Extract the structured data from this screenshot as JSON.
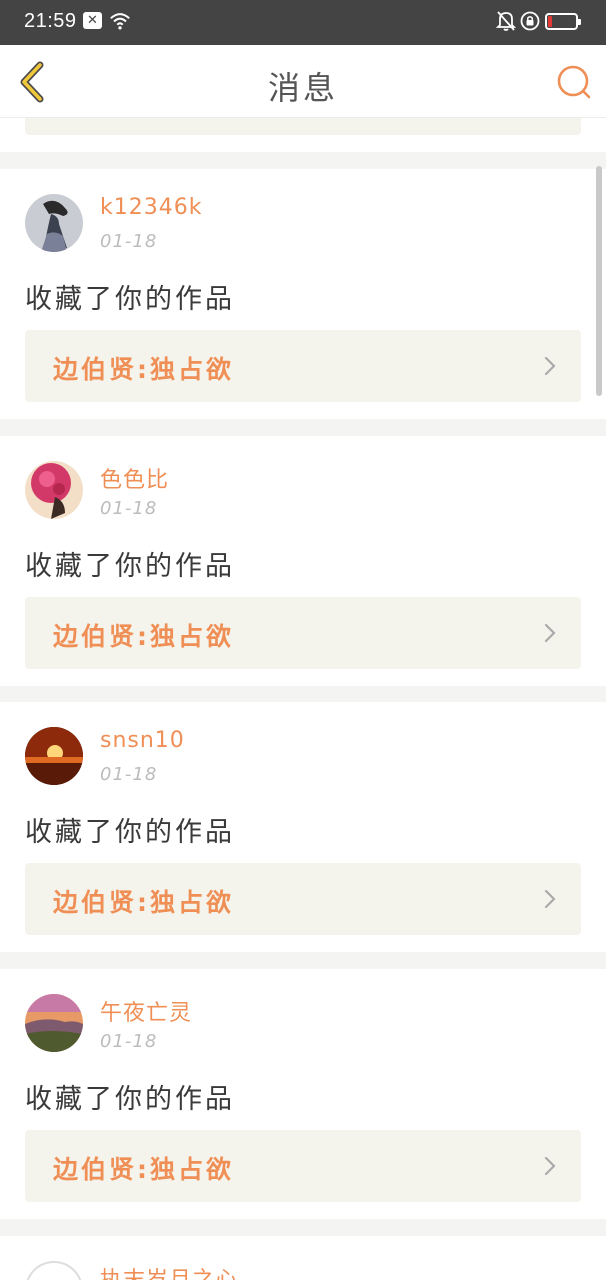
{
  "status_bar": {
    "time": "21:59",
    "icons": [
      "close-box-icon",
      "wifi-icon",
      "bell-off-icon",
      "lock-rotate-icon",
      "battery-low-icon"
    ]
  },
  "header": {
    "title": "消息",
    "back_icon": "chevron-left-icon",
    "search_icon": "search-icon"
  },
  "colors": {
    "accent": "#ef8f56",
    "back_arrow": "#f2c83b",
    "text_dark": "#3a3a3a",
    "date_gray": "#bcbcbc",
    "card_link_bg": "#f5f4ec"
  },
  "messages": [
    {
      "username": "k12346k",
      "date": "01-18",
      "action": "收藏了你的作品",
      "work_title": "边伯贤:独占欲"
    },
    {
      "username": "色色比",
      "date": "01-18",
      "action": "收藏了你的作品",
      "work_title": "边伯贤:独占欲"
    },
    {
      "username": "snsn10",
      "date": "01-18",
      "action": "收藏了你的作品",
      "work_title": "边伯贤:独占欲"
    },
    {
      "username": "午夜亡灵",
      "date": "01-18",
      "action": "收藏了你的作品",
      "work_title": "边伯贤:独占欲"
    },
    {
      "username": "执末岁月之心",
      "date": "",
      "action": "",
      "work_title": ""
    }
  ]
}
